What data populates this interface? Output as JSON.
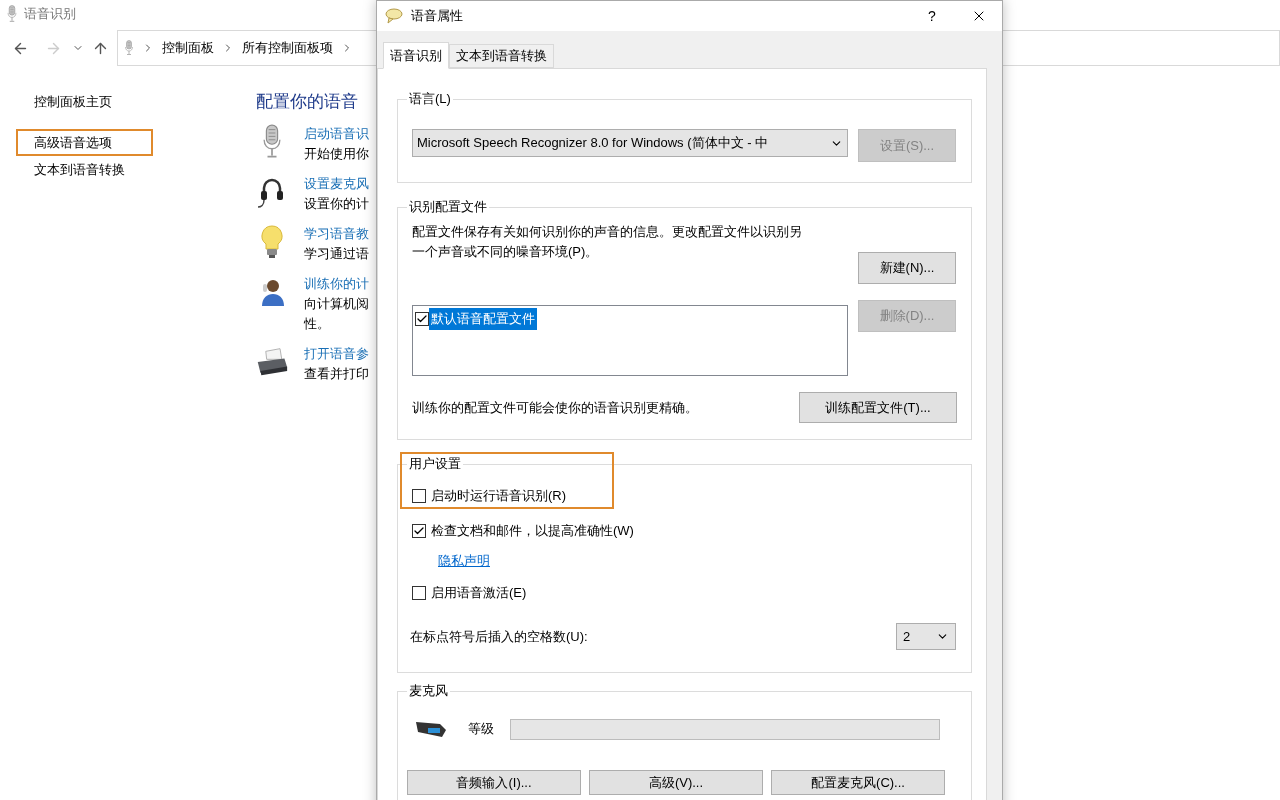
{
  "window": {
    "title": "语音识别"
  },
  "address_bar": {
    "crumbs": [
      "控制面板",
      "所有控制面板项"
    ]
  },
  "sidebar": {
    "items": [
      {
        "label": "控制面板主页",
        "highlighted": false
      },
      {
        "label": "高级语音选项",
        "highlighted": true
      },
      {
        "label": "文本到语音转换",
        "highlighted": false
      }
    ]
  },
  "main": {
    "heading": "配置你的语音",
    "tasks": [
      {
        "kind": "microphone",
        "link": "启动语音识",
        "lines": [
          "开始使用你"
        ]
      },
      {
        "kind": "headset",
        "link": "设置麦克风",
        "lines": [
          "设置你的计"
        ]
      },
      {
        "kind": "bulb",
        "link": "学习语音教",
        "lines": [
          "学习通过语"
        ]
      },
      {
        "kind": "person",
        "link": "训练你的计",
        "lines": [
          "向计算机阅",
          "性。"
        ]
      },
      {
        "kind": "printer",
        "link": "打开语音参",
        "lines": [
          "查看并打印"
        ]
      }
    ]
  },
  "dialog": {
    "title": "语音属性",
    "help": "?",
    "tabs": [
      {
        "label": "语音识别",
        "selected": true
      },
      {
        "label": "文本到语音转换",
        "selected": false
      }
    ],
    "language_group": {
      "legend": "语言(L)",
      "recognizer": "Microsoft Speech Recognizer 8.0 for Windows (简体中文 - 中",
      "settings_button": {
        "label": "设置(S)...",
        "disabled": true
      }
    },
    "profiles_group": {
      "legend": "识别配置文件",
      "description": "配置文件保存有关如何识别你的声音的信息。更改配置文件以识别另一个声音或不同的噪音环境(P)。",
      "new_button": {
        "label": "新建(N)...",
        "disabled": false
      },
      "delete_button": {
        "label": "删除(D)...",
        "disabled": true
      },
      "profiles": [
        {
          "label": "默认语音配置文件",
          "checked": true,
          "selected": true
        }
      ],
      "train_note": "训练你的配置文件可能会使你的语音识别更精确。",
      "train_button": {
        "label": "训练配置文件(T)...",
        "disabled": false
      }
    },
    "user_settings": {
      "legend": "用户设置",
      "highlighted": true,
      "options": [
        {
          "kind": "checkbox",
          "label": "启动时运行语音识别(R)",
          "checked": false
        },
        {
          "kind": "checkbox",
          "label": "检查文档和邮件，以提高准确性(W)",
          "checked": true
        },
        {
          "kind": "link",
          "label": "隐私声明"
        },
        {
          "kind": "checkbox",
          "label": "启用语音激活(E)",
          "checked": false
        },
        {
          "kind": "select",
          "label": "在标点符号后插入的空格数(U):",
          "value": "2"
        }
      ]
    },
    "microphone_group": {
      "legend": "麦克风",
      "level_label": "等级",
      "level": 0,
      "buttons": [
        "音频输入(I)...",
        "高级(V)...",
        "配置麦克风(C)..."
      ]
    }
  }
}
